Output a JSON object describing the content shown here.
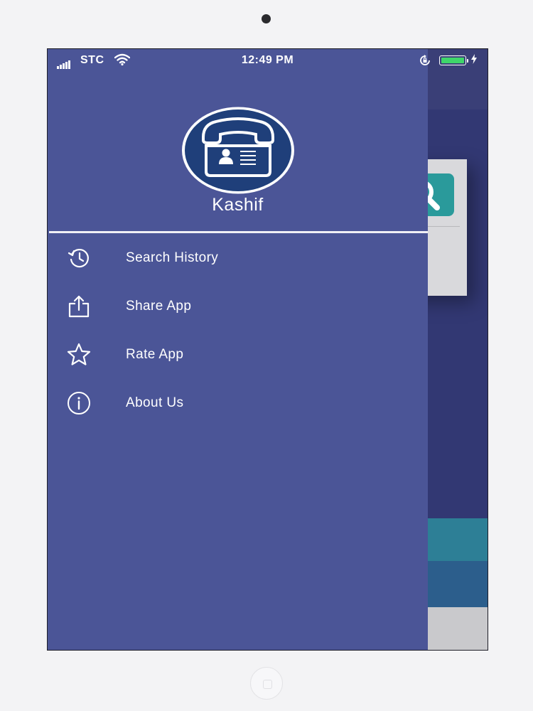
{
  "status_bar": {
    "carrier": "STC",
    "time": "12:49 PM"
  },
  "drawer": {
    "app_name": "Kashif",
    "menu": [
      {
        "label": "Search History",
        "icon": "history-icon"
      },
      {
        "label": "Share App",
        "icon": "share-icon"
      },
      {
        "label": "Rate App",
        "icon": "star-icon"
      },
      {
        "label": "About Us",
        "icon": "info-icon"
      }
    ]
  },
  "colors": {
    "drawer_background": "#4b5597",
    "logo_circle": "#1f3f7a",
    "battery": "#3fd66a"
  }
}
